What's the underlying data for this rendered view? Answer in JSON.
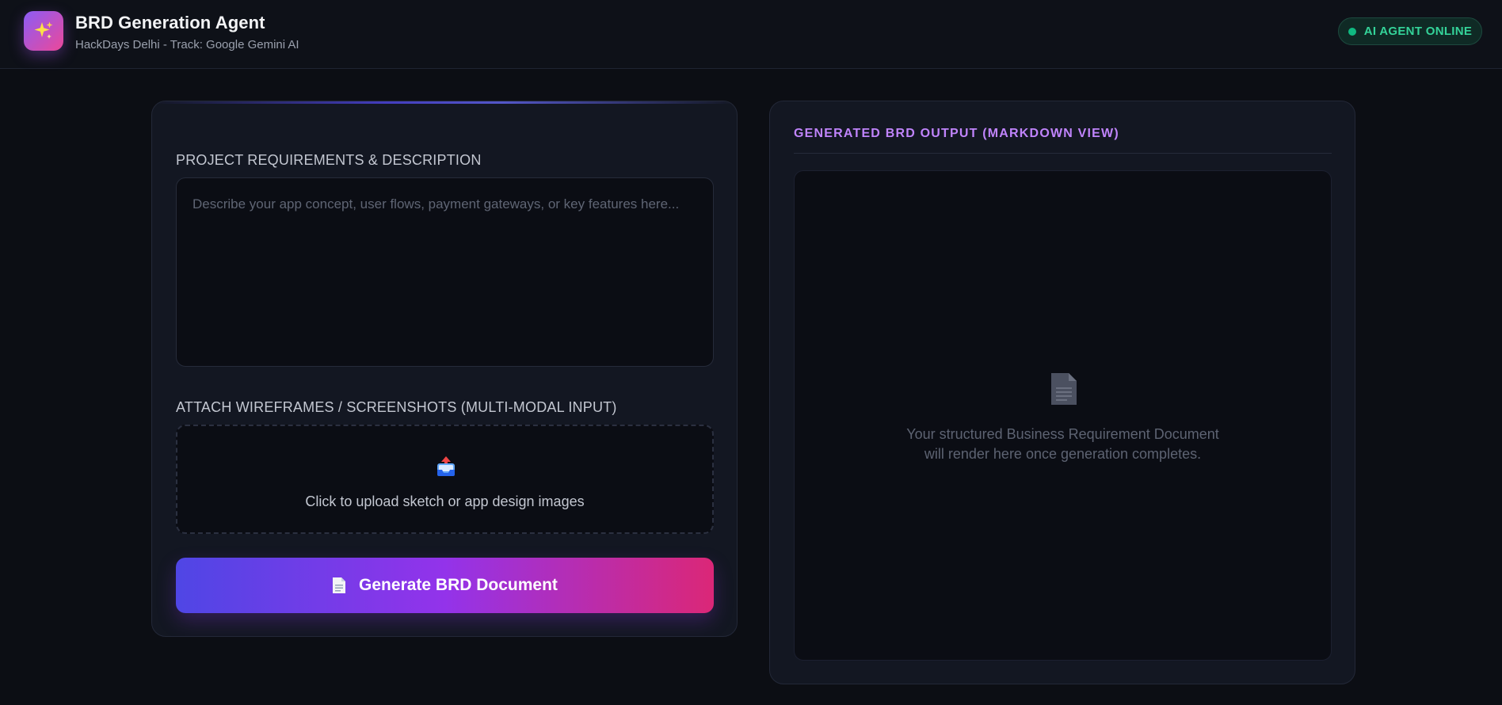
{
  "header": {
    "logo_icon": "sparkles-icon",
    "title": "BRD Generation Agent",
    "subtitle": "HackDays Delhi - Track: Google Gemini AI",
    "status": "AI AGENT ONLINE",
    "status_color": "#10b981"
  },
  "input_panel": {
    "requirements_label": "PROJECT REQUIREMENTS & DESCRIPTION",
    "requirements_value": "",
    "requirements_placeholder": "Describe your app concept, user flows, payment gateways, or key features here...",
    "attach_label": "ATTACH WIREFRAMES / SCREENSHOTS (MULTI-MODAL INPUT)",
    "upload_icon": "inbox-tray-upload-icon",
    "upload_text": "Click to upload sketch or app design images",
    "generate_icon": "document-icon",
    "generate_label": "Generate BRD Document"
  },
  "output_panel": {
    "title": "GENERATED BRD OUTPUT (MARKDOWN VIEW)",
    "empty_icon": "document-icon",
    "empty_line_1": "Your structured Business Requirement Document",
    "empty_line_2": "will render here once generation completes."
  },
  "colors": {
    "background": "#0c0e14",
    "card": "#131722",
    "accent_purple": "#c084fc",
    "button_gradient_start": "#4f46e5",
    "button_gradient_mid": "#9333ea",
    "button_gradient_end": "#db2777"
  }
}
